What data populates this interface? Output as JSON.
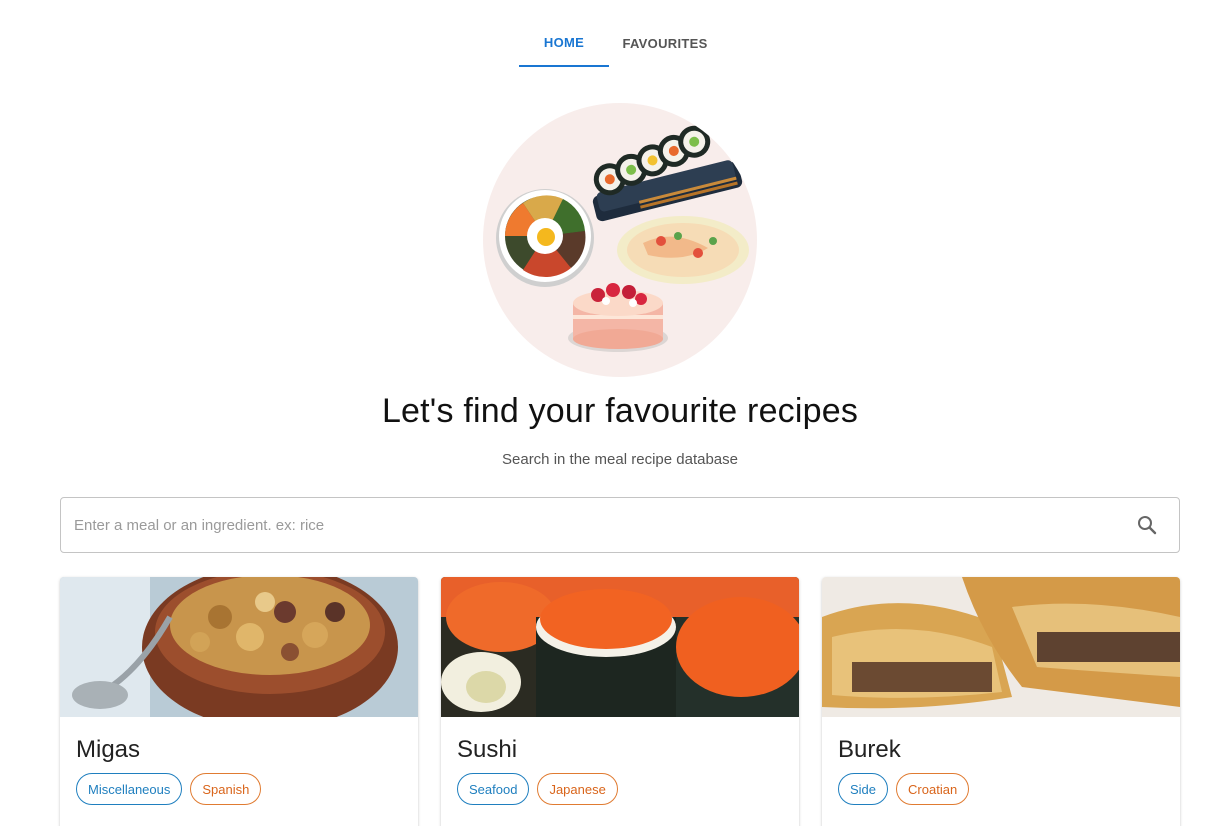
{
  "nav": {
    "tabs": [
      {
        "label": "HOME"
      },
      {
        "label": "FAVOURITES"
      }
    ],
    "active": "HOME"
  },
  "hero": {
    "title": "Let's find your favourite recipes",
    "subtitle": "Search in the meal recipe database"
  },
  "search": {
    "placeholder": "Enter a meal or an ingredient. ex: rice",
    "value": ""
  },
  "colors": {
    "accent": "#1976d2",
    "category_chip": "#1f7fbf",
    "area_chip": "#e07b31",
    "hero_bg": "#f8edeb"
  },
  "meals": [
    {
      "name": "Migas",
      "category": "Miscellaneous",
      "area": "Spanish"
    },
    {
      "name": "Sushi",
      "category": "Seafood",
      "area": "Japanese"
    },
    {
      "name": "Burek",
      "category": "Side",
      "area": "Croatian"
    }
  ]
}
